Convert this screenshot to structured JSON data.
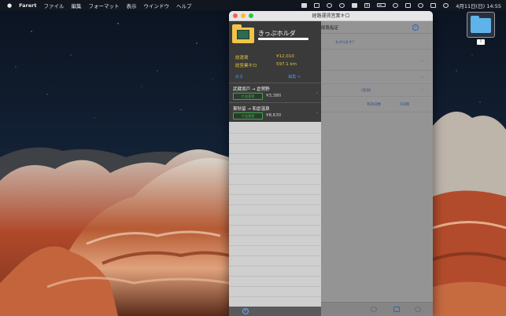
{
  "menubar": {
    "apple": "",
    "app_name": "Farert",
    "items": [
      "ファイル",
      "編集",
      "フォーマット",
      "表示",
      "ウインドウ",
      "ヘルプ"
    ],
    "clock": "4月11日(日)  14:55",
    "badge": "5"
  },
  "desktop": {
    "folder_label": "I"
  },
  "window": {
    "title": "経路運賃営業キロ",
    "sidebar": {
      "folder_name": "きっぷホルダ",
      "stats": [
        {
          "label": "総運賃",
          "value": "¥12,010"
        },
        {
          "label": "総営業キロ",
          "value": "597.1 km"
        }
      ],
      "left_link": "戻る",
      "right_link": "編集 <",
      "routes": [
        {
          "name": "武蔵境戸 → 倉賀野",
          "badge": "片道運賃",
          "price": "¥3,380"
        },
        {
          "name": "東秋留 → 和倉温泉",
          "badge": "片道運賃",
          "price": "¥8,630"
        }
      ],
      "add_button": "+"
    },
    "detail": {
      "title": "経路指定",
      "info_icon": "i",
      "rows": [
        {
          "text": "も(わ)ます？"
        },
        {
          "text": ""
        },
        {
          "text": ""
        },
        {
          "text": "(追加)"
        },
        {
          "text": "有効日数"
        },
        {
          "text": "5日間"
        }
      ]
    }
  },
  "colors": {
    "accent_blue": "#4a8fe6",
    "stat_yellow": "#e2c338",
    "badge_green": "#3fa64a"
  }
}
